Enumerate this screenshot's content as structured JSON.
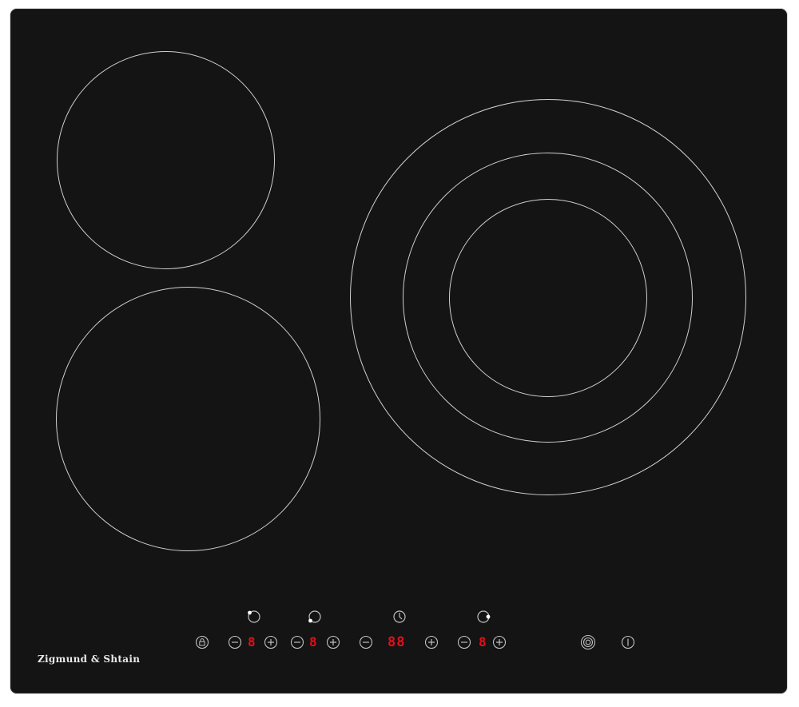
{
  "appliance": {
    "brand": "Zigmund & Shtain",
    "colors": {
      "glass": "#141414",
      "ring": "#cfcfcf",
      "display": "#e0101a"
    }
  },
  "zones": [
    {
      "id": "zone-top-left",
      "rings": 1
    },
    {
      "id": "zone-bottom-left",
      "rings": 1
    },
    {
      "id": "zone-right",
      "rings": 3
    }
  ],
  "controls": {
    "lock_icon": "lock-icon",
    "minus_icon": "minus-icon",
    "plus_icon": "plus-icon",
    "zone_selectors": [
      {
        "icon": "zone-selector-icon",
        "indicator": "top-left",
        "display": "8"
      },
      {
        "icon": "zone-selector-icon",
        "indicator": "bottom-left",
        "display": "8"
      },
      {
        "icon": "zone-selector-icon",
        "indicator": "right",
        "display": "8"
      }
    ],
    "timer": {
      "icon": "clock-icon",
      "display": "88"
    },
    "dual_zone_icon": "dual-zone-icon",
    "power_icon": "power-icon"
  }
}
